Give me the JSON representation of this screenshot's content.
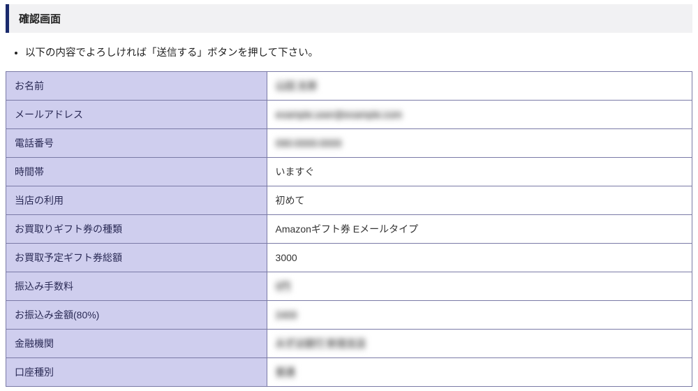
{
  "header": {
    "title": "確認画面"
  },
  "instruction": "以下の内容でよろしければ「送信する」ボタンを押して下さい。",
  "rows": [
    {
      "label": "お名前",
      "value": "山田 太郎",
      "redacted": true
    },
    {
      "label": "メールアドレス",
      "value": "example.user@example.com",
      "redacted": true
    },
    {
      "label": "電話番号",
      "value": "090-0000-0000",
      "redacted": true
    },
    {
      "label": "時間帯",
      "value": "いますぐ",
      "redacted": false
    },
    {
      "label": "当店の利用",
      "value": "初めて",
      "redacted": false
    },
    {
      "label": "お買取りギフト券の種類",
      "value": "Amazonギフト券 Eメールタイプ",
      "redacted": false
    },
    {
      "label": "お買取予定ギフト券総額",
      "value": "3000",
      "redacted": false
    },
    {
      "label": "振込み手数料",
      "value": "0円",
      "redacted": true
    },
    {
      "label": "お振込み金額(80%)",
      "value": "2400",
      "redacted": true
    },
    {
      "label": "金融機関",
      "value": "みずほ銀行  新宿支店",
      "redacted": true
    },
    {
      "label": "口座種別",
      "value": "普通",
      "redacted": true
    }
  ]
}
